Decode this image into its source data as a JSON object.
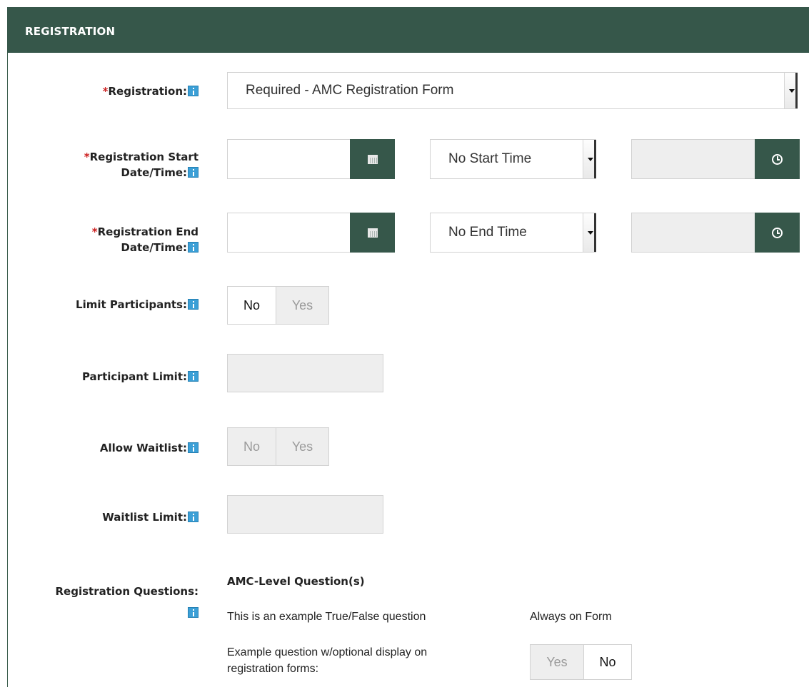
{
  "header": {
    "title": "REGISTRATION"
  },
  "fields": {
    "registration": {
      "label": "Registration:",
      "value": "Required - AMC Registration Form"
    },
    "start": {
      "label_line1": "Registration Start",
      "label_line2": "Date/Time:",
      "time_value": "No Start Time"
    },
    "end": {
      "label_line1": "Registration End",
      "label_line2": "Date/Time:",
      "time_value": "No End Time"
    },
    "limit_participants": {
      "label": "Limit Participants:",
      "no": "No",
      "yes": "Yes",
      "selected": "No"
    },
    "participant_limit": {
      "label": "Participant Limit:"
    },
    "allow_waitlist": {
      "label": "Allow Waitlist:",
      "no": "No",
      "yes": "Yes",
      "disabled": true
    },
    "waitlist_limit": {
      "label": "Waitlist Limit:"
    },
    "registration_questions": {
      "label": "Registration Questions:",
      "section_title": "AMC-Level Question(s)",
      "q1": {
        "text": "This is an example True/False question",
        "status": "Always on Form"
      },
      "q2": {
        "text_line1": "Example question w/optional display on",
        "text_line2": "registration forms:",
        "yes": "Yes",
        "no": "No",
        "selected": "No"
      }
    }
  },
  "required_marker": "*",
  "colors": {
    "header_bg": "#36574a",
    "required": "#cc1f1f",
    "info_icon": "#3b9fd6",
    "disabled_bg": "#eeeeee"
  },
  "icons": {
    "info": "info-icon",
    "calendar": "calendar-icon",
    "clock": "clock-icon",
    "dropdown": "chevron-down-icon"
  }
}
